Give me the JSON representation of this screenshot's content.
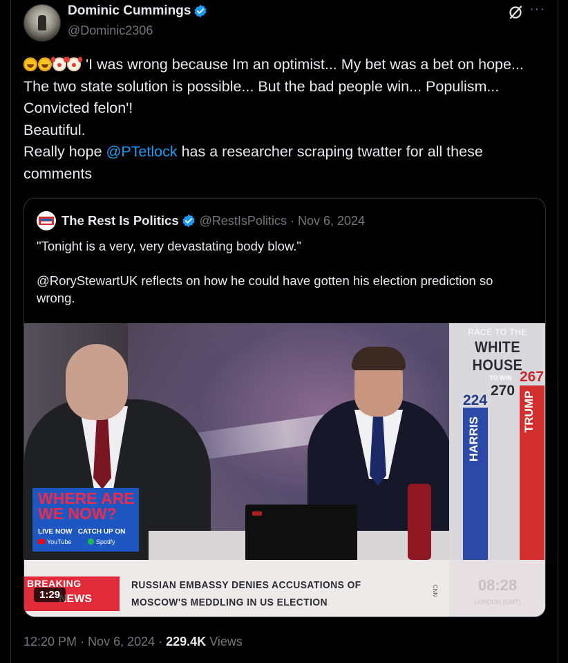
{
  "author": {
    "display_name": "Dominic Cummings",
    "handle": "@Dominic2306"
  },
  "tweet": {
    "line1_text": " 'I was wrong because Im an optimist... My bet was a bet on hope... The two state solution is possible... But the bad people win... Populism... Convicted felon'!",
    "line2_text": "Beautiful.",
    "line3_prefix": "Really hope ",
    "line3_mention": "@PTetlock",
    "line3_suffix": " has a researcher scraping twatter for all these comments"
  },
  "quote": {
    "display_name": "The Rest Is Politics",
    "handle": "@RestIsPolitics",
    "date": "· Nov 6, 2024",
    "text1": "\"Tonight is a very, very devastating body blow.\"",
    "text2": "@RoryStewartUK reflects on how he could have gotten his election prediction so wrong."
  },
  "video": {
    "duration": "1:29",
    "overlay_title": "WHERE ARE WE NOW?",
    "overlay_live": "LIVE NOW",
    "overlay_catch": "CATCH UP ON",
    "overlay_youtube": "YouTube",
    "overlay_spotify": "Spotify",
    "race_top": "RACE TO THE",
    "race_title": "WHITE HOUSE",
    "to_win": "TO WIN",
    "to_win_value": "270",
    "harris_value": "224",
    "trump_value": "267",
    "harris_label": "HARRIS",
    "trump_label": "TRUMP",
    "breaking_label": "BREAKING",
    "news_label": "NEWS",
    "headline": "RUSSIAN EMBASSY DENIES ACCUSATIONS OF MOSCOW'S MEDDLING IN US ELECTION",
    "cnn_label": "CNN",
    "clock_time": "08:28",
    "clock_zone": "LONDON (GMT)"
  },
  "meta": {
    "time": "12:20 PM",
    "date": "· Nov 6, 2024 ·",
    "views_count": "229.4K",
    "views_label": "Views"
  },
  "colors": {
    "background": "#000000",
    "text": "#e7e9ea",
    "secondary_text": "#71767b",
    "link": "#1d9bf0",
    "border": "#2f3336"
  },
  "icons": [
    "verified-badge-icon",
    "grok-icon",
    "more-icon",
    "laughing-emoji-icon",
    "clown-emoji-icon"
  ]
}
